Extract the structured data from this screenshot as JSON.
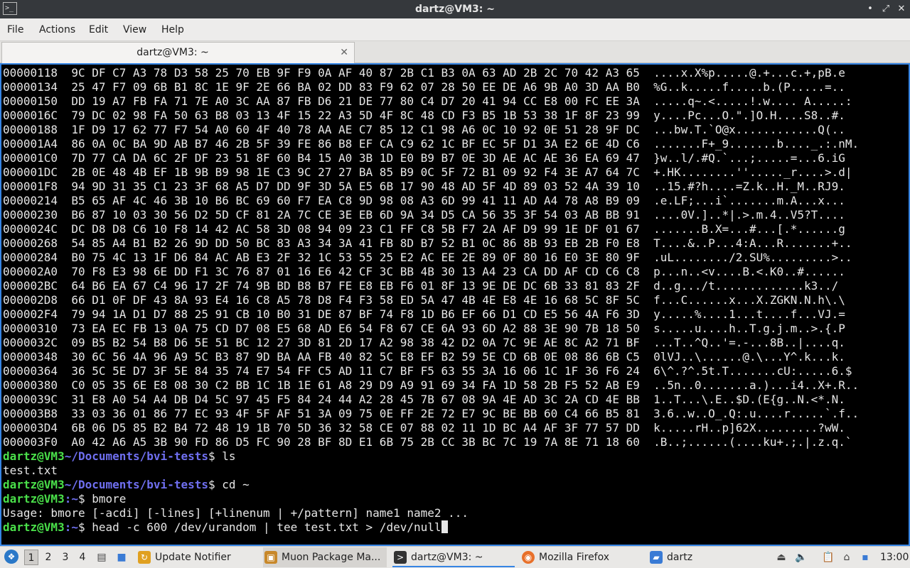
{
  "window": {
    "title": "dartz@VM3: ~",
    "app_icon": "terminal-icon",
    "buttons": [
      "•",
      "⤢",
      "✕"
    ]
  },
  "menu": [
    "File",
    "Actions",
    "Edit",
    "View",
    "Help"
  ],
  "tab": {
    "label": "dartz@VM3: ~",
    "close": "✕"
  },
  "terminal": {
    "hex_lines": [
      "00000118  9C DF C7 A3 78 D3 58 25 70 EB 9F F9 0A AF 40 87 2B C1 B3 0A 63 AD 2B 2C 70 42 A3 65  ....x.X%p.....@.+...c.+,pB.e",
      "00000134  25 47 F7 09 6B B1 8C 1E 9F 2E 66 BA 02 DD 83 F9 62 07 28 50 EE DE A6 9B A0 3D AA B0  %G..k.....f.....b.(P.....=..",
      "00000150  DD 19 A7 FB FA 71 7E A0 3C AA 87 FB D6 21 DE 77 80 C4 D7 20 41 94 CC E8 00 FC EE 3A  .....q~.<.....!.w.... A.....:",
      "0000016C  79 DC 02 98 FA 50 63 B8 03 13 4F 15 22 A3 5D 4F 8C 48 CD F3 B5 1B 53 38 1F 8F 23 99  y....Pc...O.\".]O.H....S8..#.",
      "00000188  1F D9 17 62 77 F7 54 A0 60 4F 40 78 AA AE C7 85 12 C1 98 A6 0C 10 92 0E 51 28 9F DC  ...bw.T.`O@x............Q(..",
      "000001A4  86 0A 0C BA 9D AB B7 46 2B 5F 39 FE 86 B8 EF CA C9 62 1C BF EC 5F D1 3A E2 6E 4D C6  .......F+_9.......b...._.:.nM.",
      "000001C0  7D 77 CA DA 6C 2F DF 23 51 8F 60 B4 15 A0 3B 1D E0 B9 B7 0E 3D AE AC AE 36 EA 69 47  }w..l/.#Q.`...;.....=...6.iG",
      "000001DC  2B 0E 48 4B EF 1B 9B B9 98 1E C3 9C 27 27 BA 85 B9 0C 5F 72 B1 09 92 F4 3E A7 64 7C  +.HK........''....._r....>.d|",
      "000001F8  94 9D 31 35 C1 23 3F 68 A5 D7 DD 9F 3D 5A E5 6B 17 90 48 AD 5F 4D 89 03 52 4A 39 10  ..15.#?h....=Z.k..H._M..RJ9.",
      "00000214  B5 65 AF 4C 46 3B 10 B6 BC 69 60 F7 EA C8 9D 98 08 A3 6D 99 41 11 AD A4 78 A8 B9 09  .e.LF;...i`.......m.A...x...",
      "00000230  B6 87 10 03 30 56 D2 5D CF 81 2A 7C CE 3E EB 6D 9A 34 D5 CA 56 35 3F 54 03 AB BB 91  ....0V.]..*|.>.m.4..V5?T....",
      "0000024C  DC D8 D8 C6 10 F8 14 42 AC 58 3D 08 94 09 23 C1 FF C8 5B F7 2A AF D9 99 1E DF 01 67  .......B.X=...#...[.*......g",
      "00000268  54 85 A4 B1 B2 26 9D DD 50 BC 83 A3 34 3A 41 FB 8D B7 52 B1 0C 86 8B 93 EB 2B F0 E8  T....&..P...4:A...R.......+..",
      "00000284  B0 75 4C 13 1F D6 84 AC AB E3 2F 32 1C 53 55 25 E2 AC EE 2E 89 0F 80 16 E0 3E 80 9F  .uL......../2.SU%.........>..",
      "000002A0  70 F8 E3 98 6E DD F1 3C 76 87 01 16 E6 42 CF 3C BB 4B 30 13 A4 23 CA DD AF CD C6 C8  p...n..<v....B.<.K0..#......",
      "000002BC  64 B6 EA 67 C4 96 17 2F 74 9B BD B8 B7 FE E8 EB F6 01 8F 13 9E DE DC 6B 33 81 83 2F  d..g.../t.............k3../",
      "000002D8  66 D1 0F DF 43 8A 93 E4 16 C8 A5 78 D8 F4 F3 58 ED 5A 47 4B 4E E8 4E 16 68 5C 8F 5C  f...C......x...X.ZGKN.N.h\\.\\",
      "000002F4  79 94 1A D1 D7 88 25 91 CB 10 B0 31 DE 87 BF 74 F8 1D B6 EF 66 D1 CD E5 56 4A F6 3D  y.....%....1...t....f...VJ.=",
      "00000310  73 EA EC FB 13 0A 75 CD D7 08 E5 68 AD E6 54 F8 67 CE 6A 93 6D A2 88 3E 90 7B 18 50  s.....u....h..T.g.j.m..>.{.P",
      "0000032C  09 B5 B2 54 B8 D6 5E 51 BC 12 27 3D 81 2D 17 A2 98 38 42 D2 0A 7C 9E AE 8C A2 71 BF  ...T..^Q..'=.-...8B..|....q.",
      "00000348  30 6C 56 4A 96 A9 5C B3 87 9D BA AA FB 40 82 5C E8 EF B2 59 5E CD 6B 0E 08 86 6B C5  0lVJ..\\......@.\\...Y^.k...k.",
      "00000364  36 5C 5E D7 3F 5E 84 35 74 E7 54 FF C5 AD 11 C7 BF F5 63 55 3A 16 06 1C 1F 36 F6 24  6\\^.?^.5t.T.......cU:.....6.$",
      "00000380  C0 05 35 6E E8 08 30 C2 BB 1C 1B 1E 61 A8 29 D9 A9 91 69 34 FA 1D 58 2B F5 52 AB E9  ..5n..0.......a.)...i4..X+.R..",
      "0000039C  31 E8 A0 54 A4 DB D4 5C 97 45 F5 84 24 44 A2 28 45 7B 67 08 9A 4E AD 3C 2A CD 4E BB  1..T...\\.E..$D.(E{g..N.<*.N.",
      "000003B8  33 03 36 01 86 77 EC 93 4F 5F AF 51 3A 09 75 0E FF 2E 72 E7 9C BE BB 60 C4 66 B5 81  3.6..w..O_.Q:.u....r.....`.f..",
      "000003D4  6B 06 D5 85 B2 B4 72 48 19 1B 70 5D 36 32 58 CE 07 88 02 11 1D BC A4 AF 3F 77 57 DD  k.....rH..p]62X.........?wW.",
      "000003F0  A0 42 A6 A5 3B 90 FD 86 D5 FC 90 28 BF 8D E1 6B 75 2B CC 3B BC 7C 19 7A 8E 71 18 60  .B..;......(....ku+.;.|.z.q.`"
    ],
    "session": [
      {
        "user": "dartz@VM3",
        "path": "~/Documents/bvi-tests",
        "command": "$ ls"
      },
      {
        "output": "test.txt"
      },
      {
        "user": "dartz@VM3",
        "path": "~/Documents/bvi-tests",
        "command": "$ cd ~"
      },
      {
        "user": "dartz@VM3",
        "path": ":~",
        "command": "$ bmore"
      },
      {
        "output": "Usage: bmore [-acdi] [-lines] [+linenum | +/pattern] name1 name2 ..."
      },
      {
        "user": "dartz@VM3",
        "path": ":~",
        "command": "$ head -c 600 /dev/urandom | tee test.txt > /dev/null"
      }
    ]
  },
  "taskbar": {
    "start_icon": "lxqt-start-icon",
    "workspaces": [
      "1",
      "2",
      "3",
      "4"
    ],
    "active_workspace": "1",
    "tasks": [
      {
        "label": "Update Notifier",
        "icon": "update-notifier-icon",
        "color": "#e0a020"
      },
      {
        "label": "Muon Package Ma...",
        "icon": "package-manager-icon",
        "color": "#c8882a"
      },
      {
        "label": "dartz@VM3: ~",
        "icon": "terminal-icon",
        "color": "#333333"
      },
      {
        "label": "Mozilla Firefox",
        "icon": "firefox-icon",
        "color": "#e8702a"
      },
      {
        "label": "dartz",
        "icon": "folder-icon",
        "color": "#3a7bd5"
      }
    ],
    "clock": "13:00",
    "colors": {
      "accent": "#3584e4",
      "prompt_user": "#4ae04a",
      "prompt_path": "#6f6ff0"
    }
  }
}
